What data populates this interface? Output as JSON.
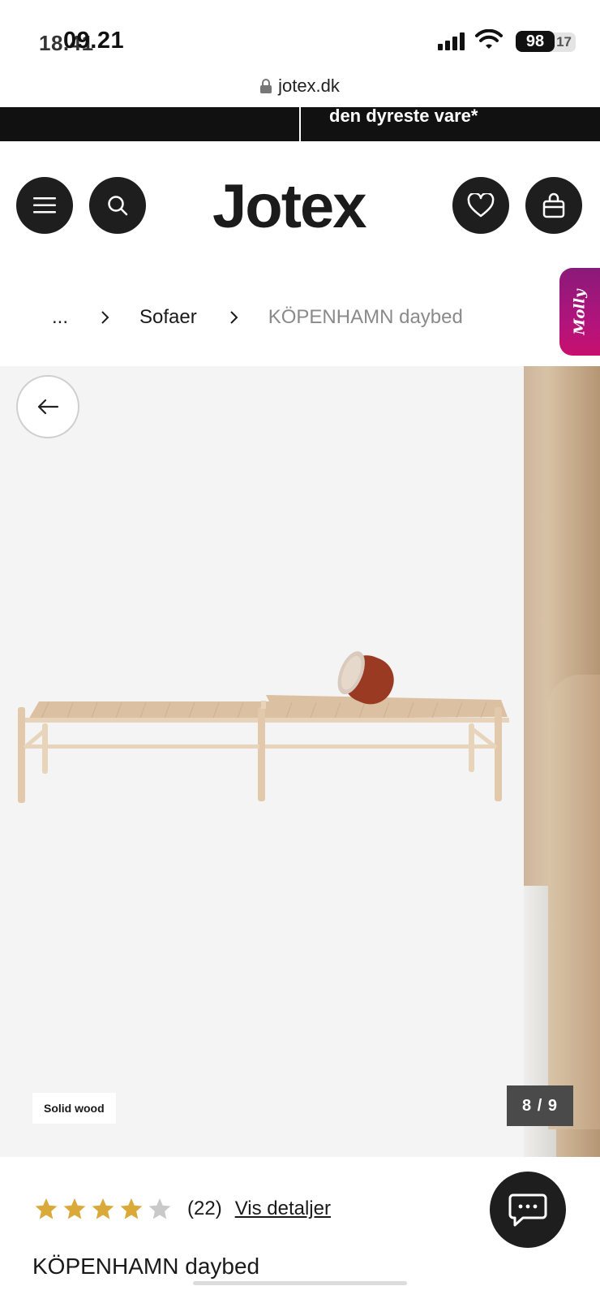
{
  "status_bar": {
    "time_ghost": "18.41",
    "time": "09.21",
    "battery": "98",
    "battery_ghost": "17"
  },
  "url_bar": {
    "domain": "jotex.dk"
  },
  "promo_banner": {
    "text": "den dyreste vare*"
  },
  "header": {
    "logo": "Jotex"
  },
  "breadcrumb": {
    "ellipsis": "...",
    "category": "Sofaer",
    "current": "KÖPENHAMN daybed"
  },
  "molly_tab": {
    "label": "Molly"
  },
  "gallery": {
    "material_tag": "Solid wood",
    "counter": "8 / 9",
    "current_slide": 8,
    "total_slides": 9
  },
  "product": {
    "rating_stars": 4,
    "rating_max": 5,
    "review_count": "(22)",
    "details_link": "Vis detaljer",
    "title": "KÖPENHAMN daybed"
  },
  "colors": {
    "star_filled": "#d9a93a",
    "star_empty": "#c9c9c9",
    "dark": "#1e1e1e",
    "molly": "#b0147c"
  }
}
